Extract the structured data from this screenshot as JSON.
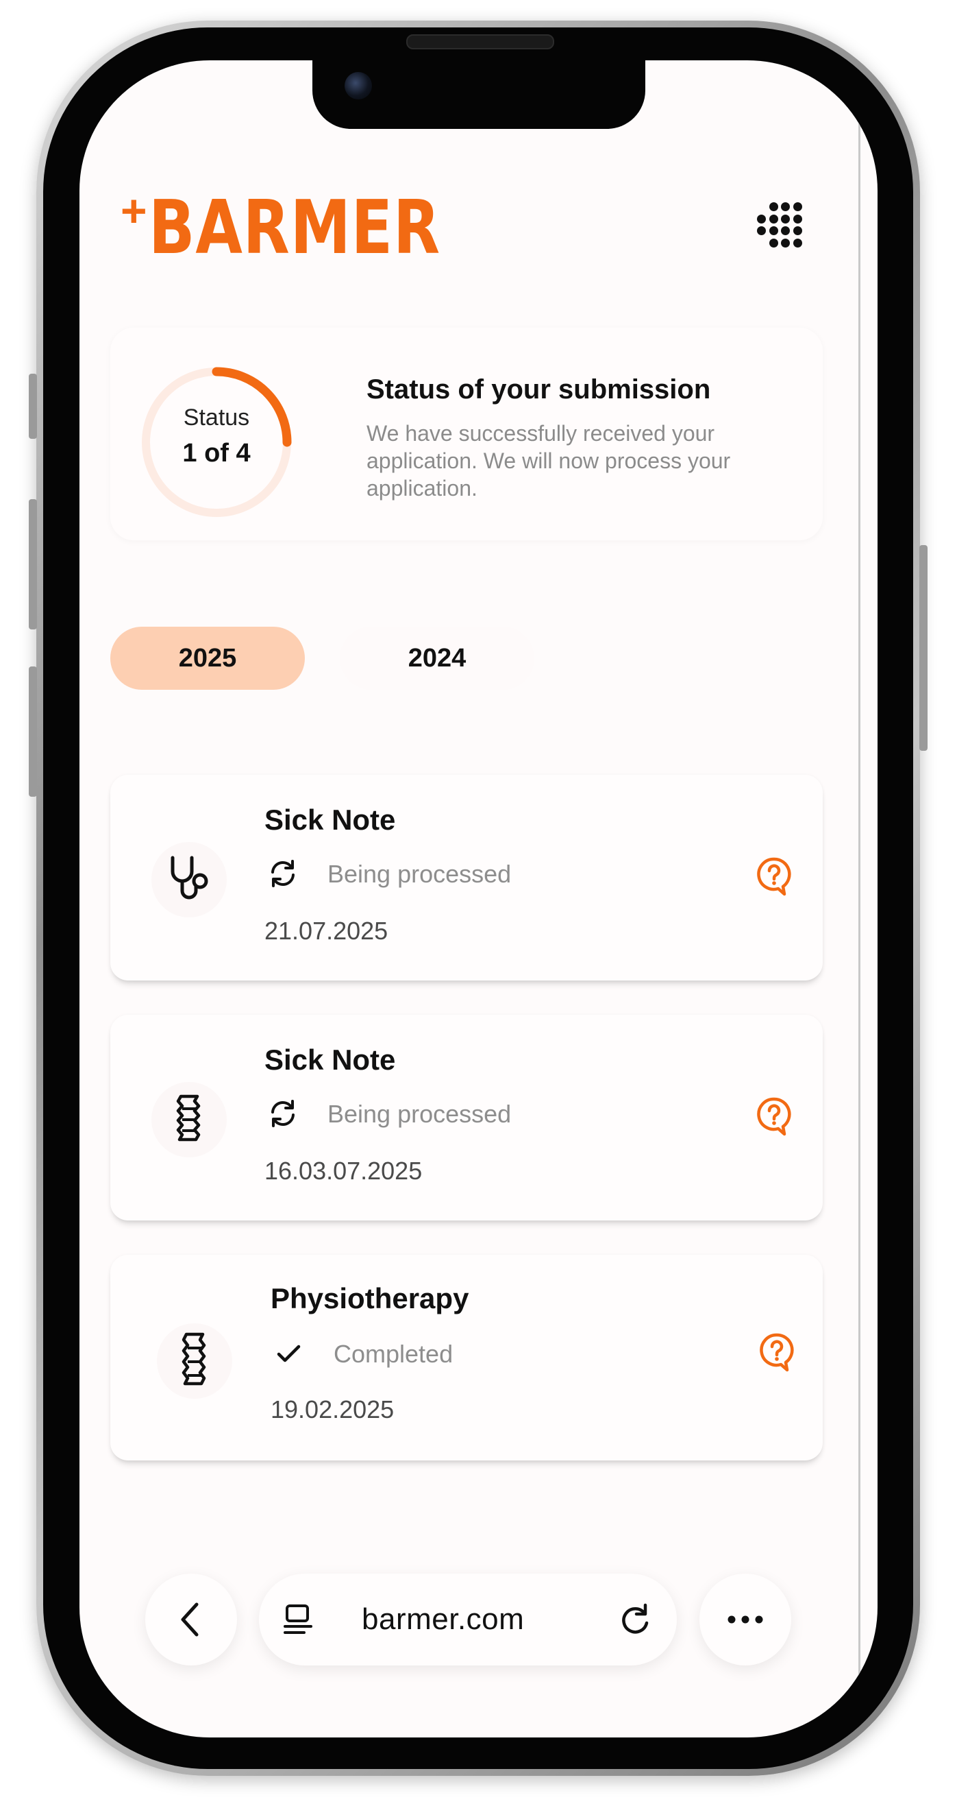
{
  "brand": {
    "logo_plus": "+",
    "logo_text": "BARMER",
    "accent_color": "#f26a13"
  },
  "status": {
    "label": "Status",
    "count": "1 of 4",
    "progress_fraction": 0.25,
    "title": "Status of your submission",
    "description": "We have successfully received your application. We will now process your application."
  },
  "tabs": [
    {
      "label": "2025",
      "selected": true
    },
    {
      "label": "2024",
      "selected": false
    }
  ],
  "submissions": [
    {
      "title": "Sick Note",
      "status": "Being processed",
      "status_icon": "sync-icon",
      "category_icon": "stethoscope-icon",
      "date": "21.07.2025"
    },
    {
      "title": "Sick Note",
      "status": "Being processed",
      "status_icon": "sync-icon",
      "category_icon": "spine-icon",
      "date": "16.03.07.2025"
    },
    {
      "title": "Physiotherapy",
      "status": "Completed",
      "status_icon": "check-icon",
      "category_icon": "spine-icon",
      "date": "19.02.2025"
    }
  ],
  "browser": {
    "url": "barmer.com"
  }
}
